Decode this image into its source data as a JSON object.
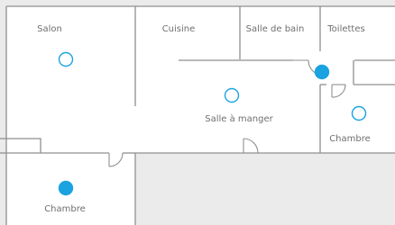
{
  "floorplan": {
    "colors": {
      "wall": "#8f8f8f",
      "outside": "#ebebeb",
      "floor": "#ffffff",
      "sensor": "#1aa3e0"
    },
    "rooms": [
      {
        "key": "salon",
        "label": "Salon",
        "sensor": "inactive"
      },
      {
        "key": "cuisine",
        "label": "Cuisine",
        "sensor": "none"
      },
      {
        "key": "salle-de-bain",
        "label": "Salle de bain",
        "sensor": "none"
      },
      {
        "key": "toilettes",
        "label": "Toilettes",
        "sensor": "active"
      },
      {
        "key": "salle-a-manger",
        "label": "Salle à manger",
        "sensor": "inactive"
      },
      {
        "key": "chambre-droite",
        "label": "Chambre",
        "sensor": "inactive"
      },
      {
        "key": "chambre-gauche",
        "label": "Chambre",
        "sensor": "active"
      }
    ]
  }
}
